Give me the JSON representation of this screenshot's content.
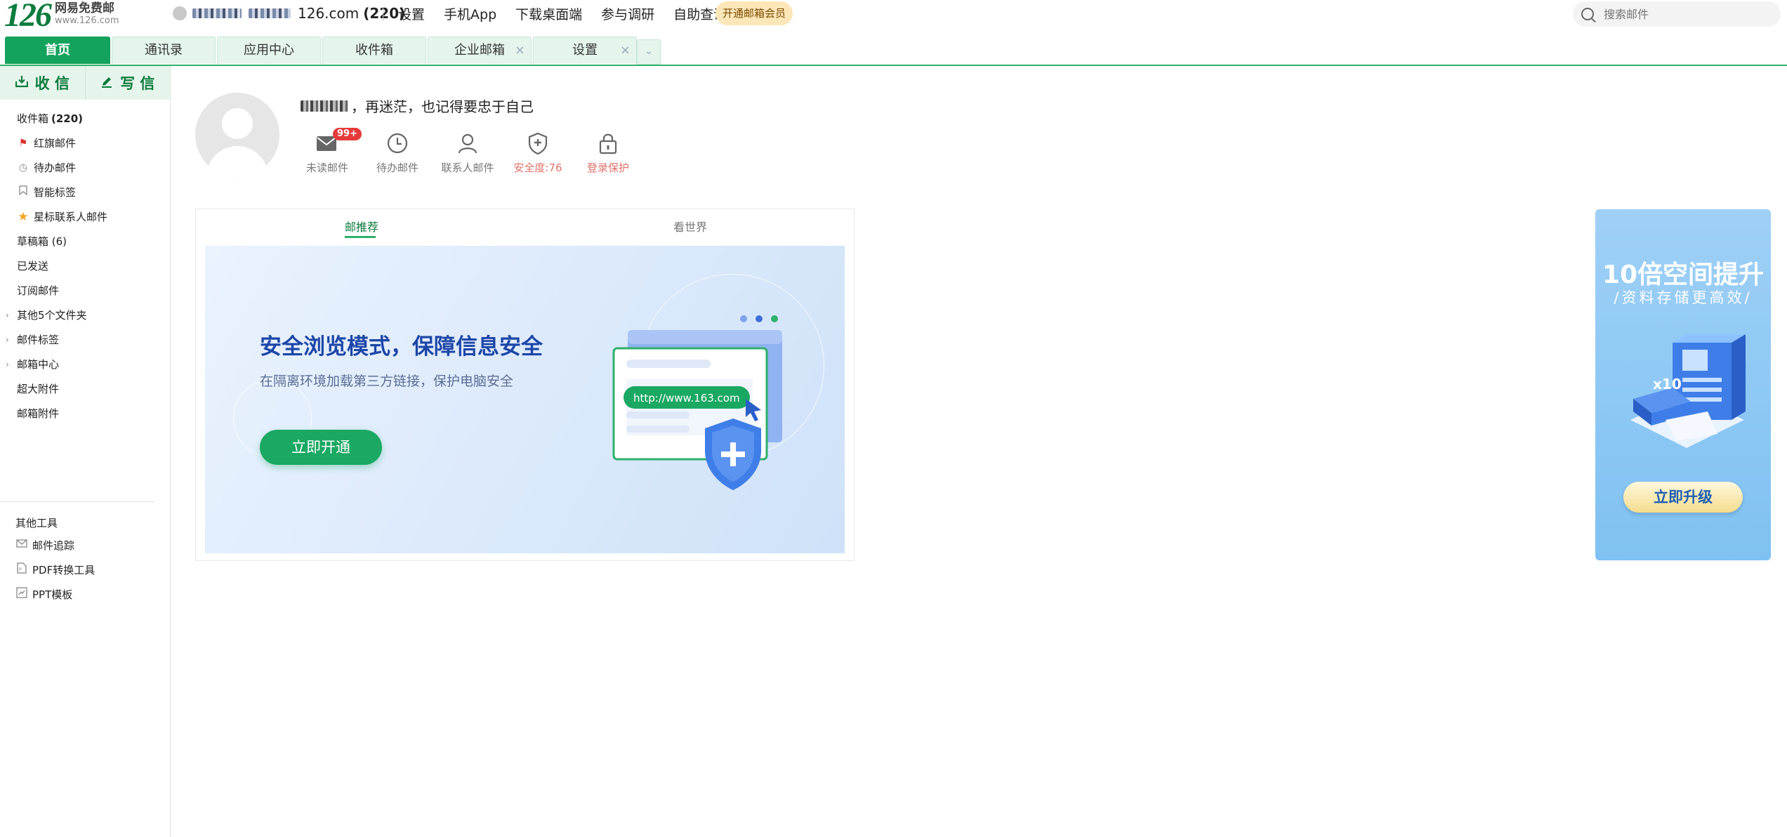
{
  "brand": {
    "logo_number": "126",
    "name": "网易免费邮",
    "url": "www.126.com"
  },
  "account": {
    "domain": "126.com",
    "count": "(220)"
  },
  "top_nav": [
    "设置",
    "手机App",
    "下载桌面端",
    "参与调研",
    "自助查询"
  ],
  "vip_button": "开通邮箱会员",
  "search": {
    "placeholder": "搜索邮件"
  },
  "tabs": [
    {
      "label": "首页",
      "active": true,
      "closable": false
    },
    {
      "label": "通讯录",
      "active": false,
      "closable": false
    },
    {
      "label": "应用中心",
      "active": false,
      "closable": false
    },
    {
      "label": "收件箱",
      "active": false,
      "closable": false
    },
    {
      "label": "企业邮箱",
      "active": false,
      "closable": true
    },
    {
      "label": "设置",
      "active": false,
      "closable": true
    }
  ],
  "compose": {
    "receive": "收 信",
    "write": "写 信"
  },
  "folders": {
    "inbox": {
      "label": "收件箱",
      "count": "(220)"
    },
    "flagged": "红旗邮件",
    "todo": "待办邮件",
    "smart_tags": "智能标签",
    "star_contacts": "星标联系人邮件",
    "drafts": "草稿箱 (6)",
    "sent": "已发送",
    "subscriptions": "订阅邮件",
    "other_folders": "其他5个文件夹",
    "mail_tags": "邮件标签",
    "mailbox_center": "邮箱中心",
    "large_attachments": "超大附件",
    "mailbox_attachments": "邮箱附件"
  },
  "tools": {
    "title": "其他工具",
    "items": [
      "邮件追踪",
      "PDF转换工具",
      "PPT模板"
    ]
  },
  "profile": {
    "greeting": "再迷茫，也记得要忠于自己",
    "comma": "，",
    "stats": [
      {
        "label": "未读邮件",
        "badge": "99+",
        "icon": "envelope-icon",
        "red": false
      },
      {
        "label": "待办邮件",
        "icon": "clock-icon",
        "red": false
      },
      {
        "label": "联系人邮件",
        "icon": "contact-icon",
        "red": false
      },
      {
        "label": "安全度:76",
        "icon": "shield-icon",
        "red": true
      },
      {
        "label": "登录保护",
        "icon": "lock-icon",
        "red": true
      }
    ]
  },
  "recommend": {
    "tabs": [
      "邮推荐",
      "看世界"
    ],
    "banner": {
      "title": "安全浏览模式，保障信息安全",
      "subtitle": "在隔离环境加载第三方链接，保护电脑安全",
      "button": "立即开通",
      "url_pill": "http://www.163.com"
    }
  },
  "ad": {
    "title": "10倍空间提升",
    "subtitle": "/资料存储更高效/",
    "multiplier": "x10",
    "button": "立即升级"
  },
  "colors": {
    "brand_green": "#13a35c",
    "dark_green": "#0c7b3e",
    "banner_blue": "#1d46a8",
    "badge_red": "#e53b3b"
  }
}
